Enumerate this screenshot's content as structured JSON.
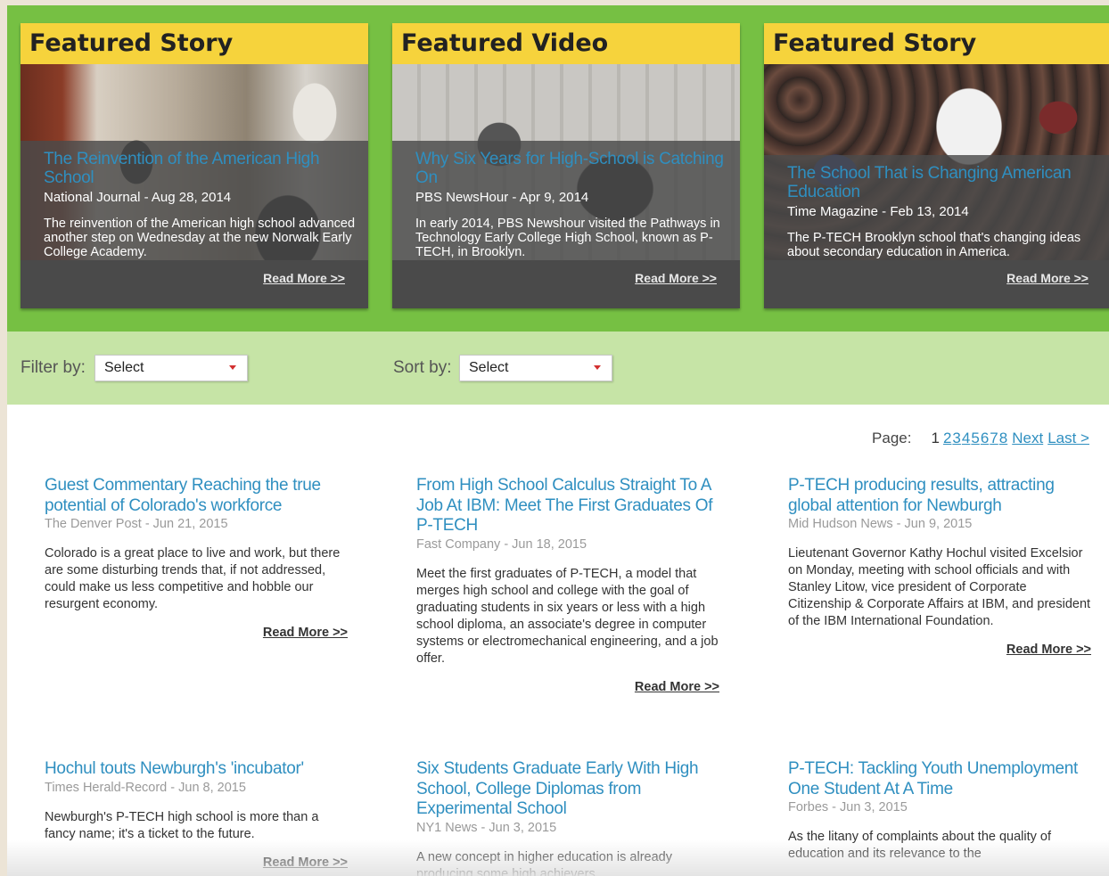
{
  "featured": [
    {
      "heading": "Featured Story",
      "title": "The Reinvention of the American High School",
      "source": "National Journal - Aug 28, 2014",
      "summary": "The reinvention of the American high school advanced another step on Wednesday at the new Norwalk Early College Academy.",
      "read_more": "Read More >>"
    },
    {
      "heading": "Featured Video",
      "title": "Why Six Years for High-School is Catching On",
      "source": "PBS NewsHour - Apr 9, 2014",
      "summary": "In early 2014, PBS Newshour visited the Pathways in Technology Early College High School, known as P-TECH, in Brooklyn.",
      "read_more": "Read More >>"
    },
    {
      "heading": "Featured Story",
      "title": "The School That is Changing American Education",
      "source": "Time Magazine - Feb 13, 2014",
      "summary": "The P-TECH Brooklyn school that's changing ideas about secondary education in America.",
      "read_more": "Read More >>"
    }
  ],
  "filter": {
    "label": "Filter by:",
    "selected": "Select"
  },
  "sort": {
    "label": "Sort by:",
    "selected": "Select"
  },
  "pagination": {
    "label": "Page:",
    "current": "1",
    "pages": [
      "2",
      "3",
      "4",
      "5",
      "6",
      "7",
      "8"
    ],
    "next": "Next",
    "last": "Last >"
  },
  "articles": [
    {
      "title": "Guest Commentary Reaching the true potential of Colorado's workforce",
      "meta": "The Denver Post - Jun 21, 2015",
      "summary": "Colorado is a great place to live and work, but there are some disturbing trends that, if not addressed, could make us less competitive and hobble our resurgent economy.",
      "read_more": "Read More >>"
    },
    {
      "title": "From High School Calculus Straight To A Job At IBM: Meet The First Graduates Of P-TECH",
      "meta": "Fast Company - Jun 18, 2015",
      "summary": "Meet the first graduates of P-TECH, a model that merges high school and college with the goal of graduating students in six years or less with a high school diploma, an associate's degree in computer systems or electromechanical engineering, and a job offer.",
      "read_more": "Read More >>"
    },
    {
      "title": "P-TECH producing results, attracting global attention for Newburgh",
      "meta": "Mid Hudson News - Jun 9, 2015",
      "summary": "Lieutenant Governor Kathy Hochul visited Excelsior on Monday, meeting with school officials and with Stanley Litow, vice president of Corporate Citizenship & Corporate Affairs at IBM, and president of the IBM International Foundation.",
      "read_more": "Read More >>"
    },
    {
      "title": "Hochul touts Newburgh's 'incubator'",
      "meta": "Times Herald-Record - Jun 8, 2015",
      "summary": "Newburgh's P-TECH high school is more than a fancy name; it's a ticket to the future.",
      "read_more": "Read More >>"
    },
    {
      "title": "Six Students Graduate Early With High School, College Diplomas from Experimental School",
      "meta": "NY1 News - Jun 3, 2015",
      "summary": "A new concept in higher education is already producing some high achievers.",
      "read_more": ""
    },
    {
      "title": "P-TECH: Tackling Youth Unemployment One Student At A Time",
      "meta": "Forbes - Jun 3, 2015",
      "summary": "As the litany of complaints about the quality of education and its relevance to the",
      "read_more": ""
    }
  ]
}
